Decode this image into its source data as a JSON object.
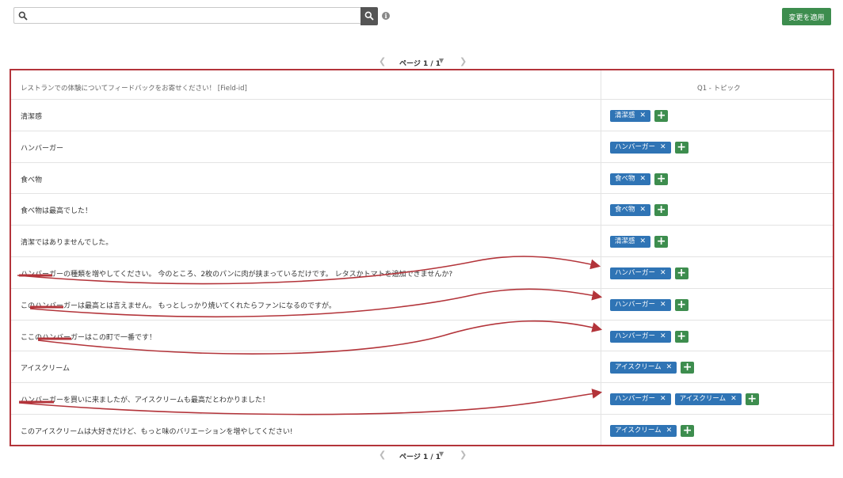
{
  "toolbar": {
    "search_value": "",
    "apply_label": "変更を適用"
  },
  "pager_top": {
    "label": "ページ 1 / 1"
  },
  "pager_bottom": {
    "label": "ページ 1 / 1"
  },
  "table": {
    "header_text": "レストランでの体験についてフィードバックをお寄せください！ [Field-id]",
    "header_topic": "Q1 - トピック",
    "rows": [
      {
        "text": "清潔感",
        "tags": [
          "清潔感"
        ]
      },
      {
        "text": "ハンバーガー",
        "tags": [
          "ハンバーガー"
        ]
      },
      {
        "text": "食べ物",
        "tags": [
          "食べ物"
        ]
      },
      {
        "text": "食べ物は最高でした！",
        "tags": [
          "食べ物"
        ]
      },
      {
        "text": "清潔ではありませんでした。",
        "tags": [
          "清潔感"
        ]
      },
      {
        "text": "ハンバーガーの種類を増やしてください。 今のところ、2枚のパンに肉が挟まっているだけです。 レタスかトマトを追加できませんか?",
        "tags": [
          "ハンバーガー"
        ]
      },
      {
        "text": "このハンバーガーは最高とは言えません。 もっとしっかり焼いてくれたらファンになるのですが。",
        "tags": [
          "ハンバーガー"
        ]
      },
      {
        "text": "ここのハンバーガーはこの町で一番です！",
        "tags": [
          "ハンバーガー"
        ]
      },
      {
        "text": "アイスクリーム",
        "tags": [
          "アイスクリーム"
        ]
      },
      {
        "text": "ハンバーガーを買いに来ましたが、アイスクリームも最高だとわかりました！",
        "tags": [
          "ハンバーガー",
          "アイスクリーム"
        ]
      },
      {
        "text": "このアイスクリームは大好きだけど、もっと味のバリエーションを増やしてください!",
        "tags": [
          "アイスクリーム"
        ]
      }
    ]
  },
  "colors": {
    "tag": "#2f74b5",
    "add": "#3d8d4e",
    "annotation": "#b3343a"
  }
}
